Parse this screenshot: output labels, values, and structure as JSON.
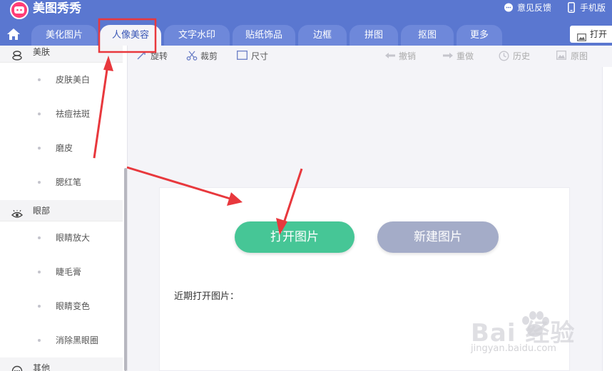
{
  "app": {
    "name": "美图秀秀",
    "feedback_label": "意见反馈",
    "mobile_label": "手机版"
  },
  "tabs": [
    {
      "label": "美化图片",
      "active": false
    },
    {
      "label": "人像美容",
      "active": true
    },
    {
      "label": "文字水印",
      "active": false
    },
    {
      "label": "贴纸饰品",
      "active": false
    },
    {
      "label": "边框",
      "active": false
    },
    {
      "label": "拼图",
      "active": false
    },
    {
      "label": "抠图",
      "active": false
    },
    {
      "label": "更多",
      "active": false
    }
  ],
  "open_button_label": "打开",
  "sidebar": {
    "sections": [
      {
        "title": "美肤",
        "icon": "skin-icon",
        "items": [
          "皮肤美白",
          "祛痘祛斑",
          "磨皮",
          "腮红笔"
        ]
      },
      {
        "title": "眼部",
        "icon": "eye-icon",
        "items": [
          "眼睛放大",
          "睫毛膏",
          "眼睛变色",
          "消除黑眼圈"
        ]
      },
      {
        "title": "其他",
        "icon": "more-icon",
        "items": []
      }
    ]
  },
  "toolbar": {
    "rotate": "旋转",
    "crop": "裁剪",
    "size": "尺寸",
    "undo": "撤销",
    "redo": "重做",
    "history": "历史",
    "original": "原图"
  },
  "main": {
    "open_image_label": "打开图片",
    "new_image_label": "新建图片",
    "recent_label": "近期打开图片："
  },
  "watermark": {
    "main": "Bai 经验",
    "sub": "jingyan.baidu.com"
  },
  "colors": {
    "header": "#5a77d0",
    "tab": "#6e88da",
    "open_button": "#46c696",
    "new_button": "#a4acc8",
    "annotation": "#e8383d"
  }
}
